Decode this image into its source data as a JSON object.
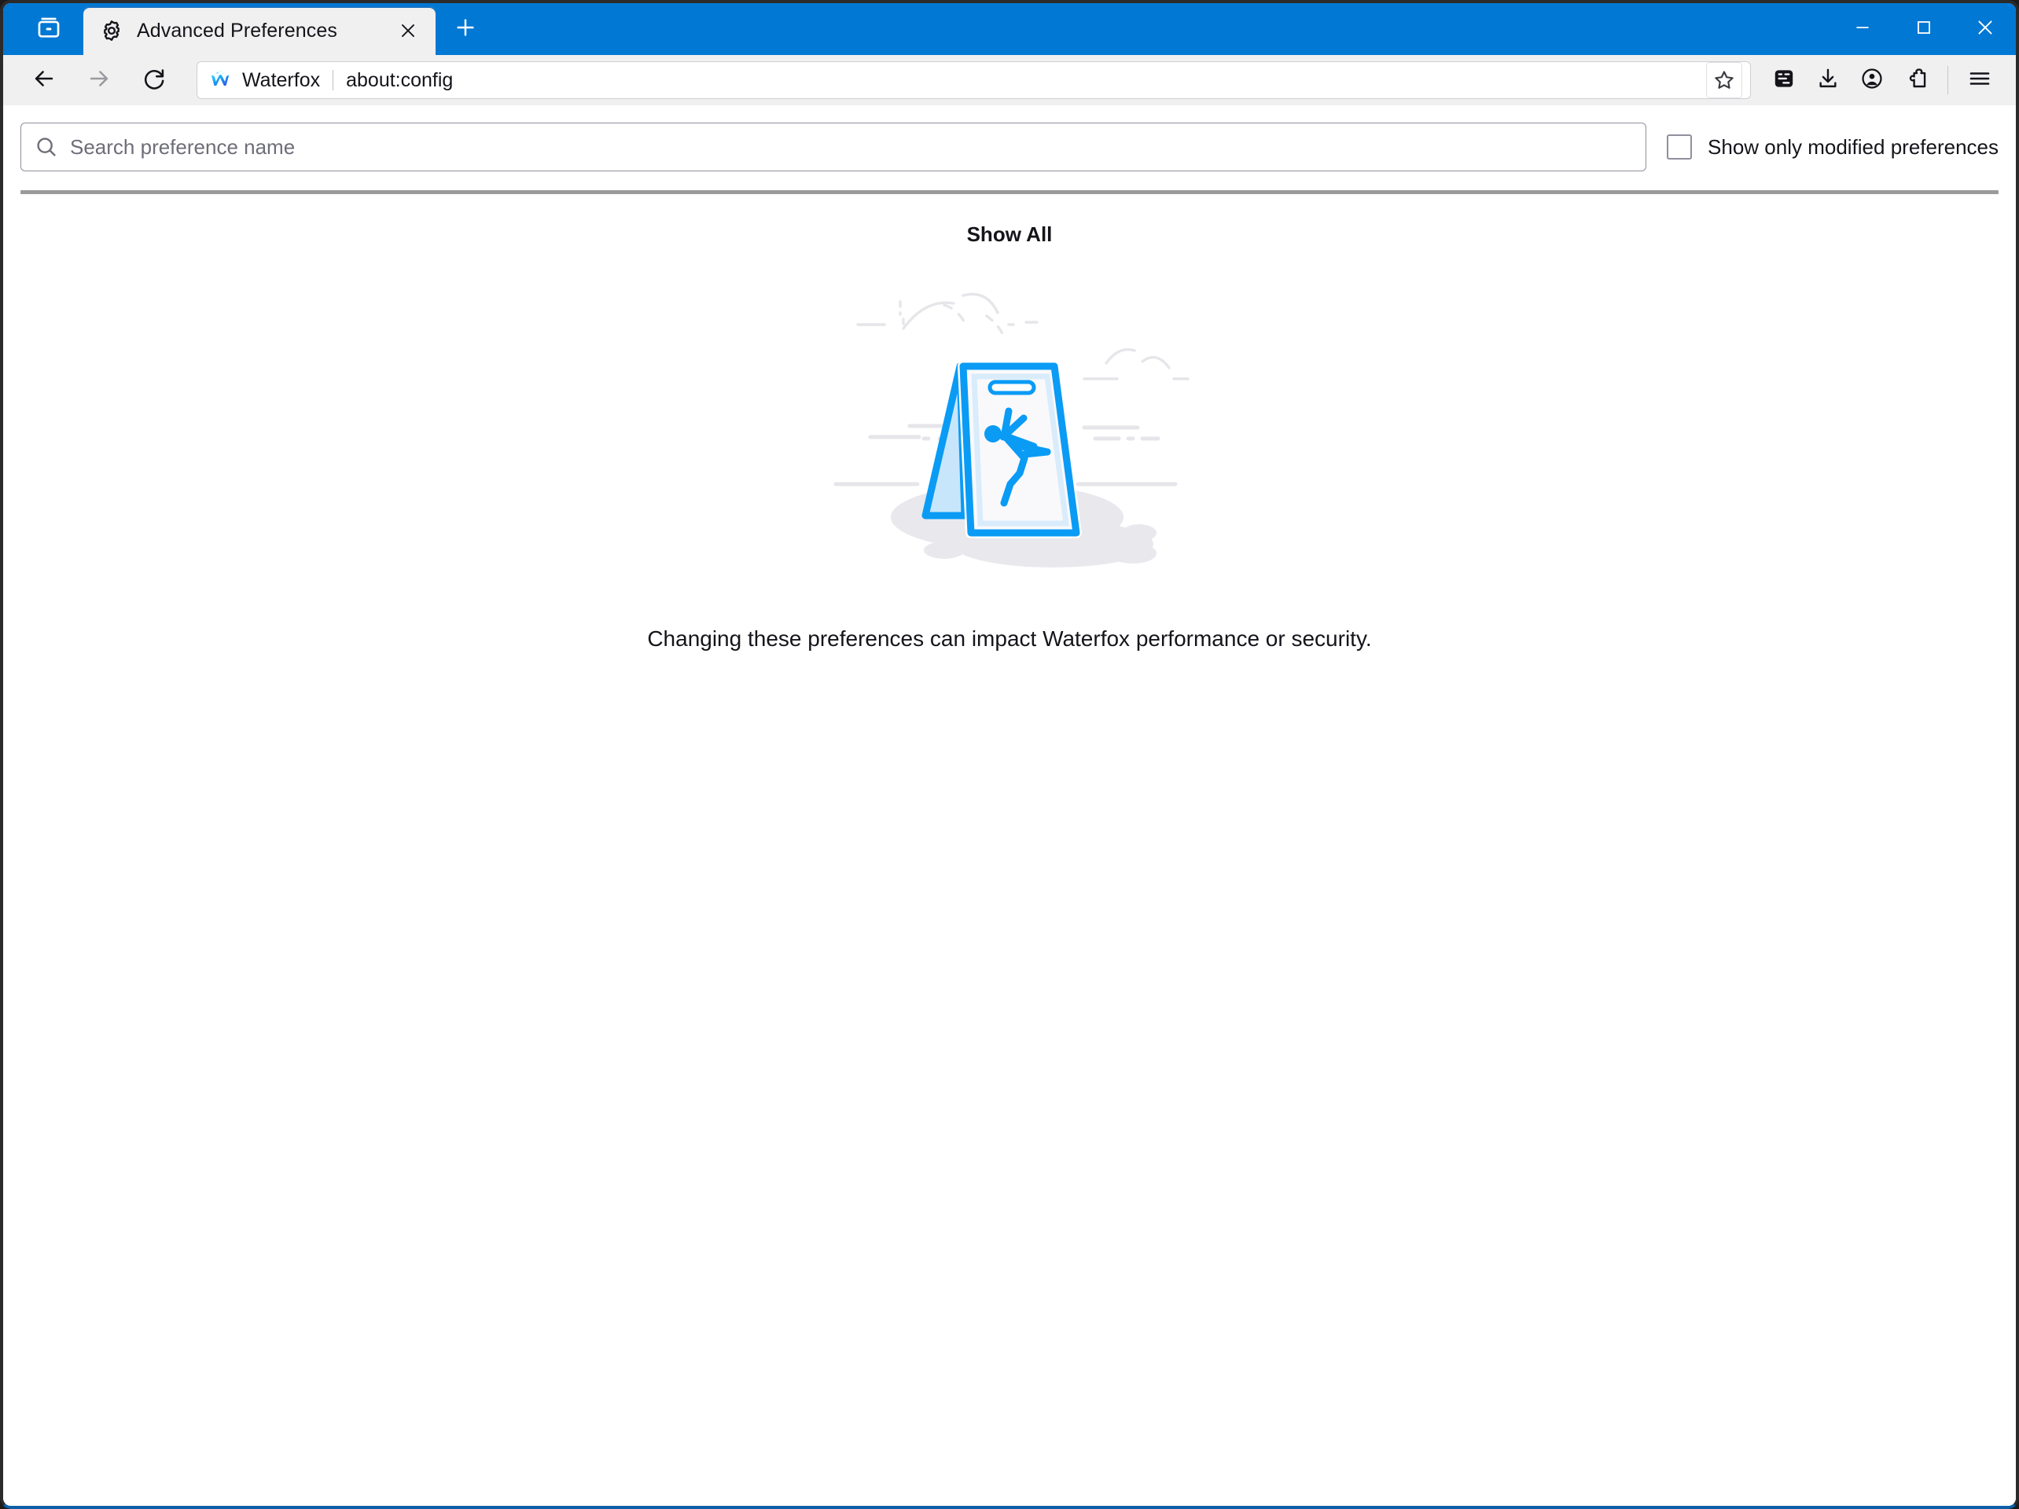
{
  "window": {
    "titlebar_color": "#0078d4",
    "controls": [
      {
        "name": "minimize",
        "glyph": "minimize-icon"
      },
      {
        "name": "maximize",
        "glyph": "maximize-icon"
      },
      {
        "name": "close",
        "glyph": "close-icon"
      }
    ]
  },
  "tabstrip": {
    "firefox_view_icon": "tab-list-icon",
    "new_tab_icon": "plus-icon",
    "tabs": [
      {
        "title": "Advanced Preferences",
        "favicon": "gear-icon",
        "close_icon": "close-icon",
        "active": true
      }
    ]
  },
  "navbar": {
    "back_icon": "arrow-left-icon",
    "forward_icon": "arrow-right-icon",
    "reload_icon": "reload-icon",
    "urlbar": {
      "brand_icon": "waterfox-logo-icon",
      "brand": "Waterfox",
      "url": "about:config",
      "bookmark_icon": "star-icon"
    },
    "actions": [
      {
        "name": "save-to-pocket-button",
        "icon": "pocket-icon"
      },
      {
        "name": "downloads-button",
        "icon": "download-icon"
      },
      {
        "name": "account-button",
        "icon": "account-circle-icon"
      },
      {
        "name": "extensions-button",
        "icon": "puzzle-piece-icon"
      },
      {
        "name": "app-menu-button",
        "icon": "hamburger-menu-icon"
      }
    ]
  },
  "page": {
    "search": {
      "placeholder": "Search preference name",
      "value": "",
      "icon": "search-icon"
    },
    "show_modified": {
      "label": "Show only modified preferences",
      "checked": false
    },
    "show_all_button": "Show All",
    "illustration": {
      "name": "wet-floor-caution-sign-illustration",
      "accent": "#0a9bf5",
      "panel": "#f9f9fb",
      "panel_light": "#d9ecfb",
      "shadow": "#e8e8ed"
    },
    "warning": "Changing these preferences can impact Waterfox performance or security."
  }
}
